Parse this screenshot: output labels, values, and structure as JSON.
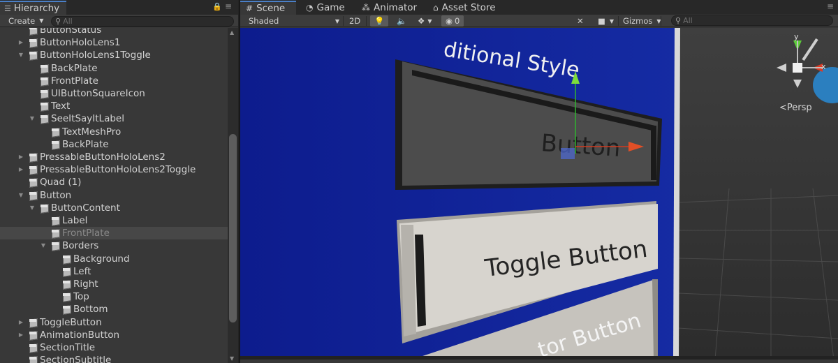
{
  "hierarchy": {
    "tab_label": "Hierarchy",
    "create_label": "Create",
    "search_placeholder": "All",
    "rows": [
      {
        "label": "ButtonStatus",
        "depth": 1,
        "fold": "",
        "dim": false,
        "sel": false
      },
      {
        "label": "ButtonHoloLens1",
        "depth": 1,
        "fold": "▶",
        "dim": false,
        "sel": false
      },
      {
        "label": "ButtonHoloLens1Toggle",
        "depth": 1,
        "fold": "▼",
        "dim": false,
        "sel": false
      },
      {
        "label": "BackPlate",
        "depth": 2,
        "fold": "",
        "dim": false,
        "sel": false
      },
      {
        "label": "FrontPlate",
        "depth": 2,
        "fold": "",
        "dim": false,
        "sel": false
      },
      {
        "label": "UIButtonSquareIcon",
        "depth": 2,
        "fold": "",
        "dim": false,
        "sel": false
      },
      {
        "label": "Text",
        "depth": 2,
        "fold": "",
        "dim": false,
        "sel": false
      },
      {
        "label": "SeeItSayItLabel",
        "depth": 2,
        "fold": "▼",
        "dim": false,
        "sel": false
      },
      {
        "label": "TextMeshPro",
        "depth": 3,
        "fold": "",
        "dim": false,
        "sel": false
      },
      {
        "label": "BackPlate",
        "depth": 3,
        "fold": "",
        "dim": false,
        "sel": false
      },
      {
        "label": "PressableButtonHoloLens2",
        "depth": 1,
        "fold": "▶",
        "dim": false,
        "sel": false
      },
      {
        "label": "PressableButtonHoloLens2Toggle",
        "depth": 1,
        "fold": "▶",
        "dim": false,
        "sel": false
      },
      {
        "label": "Quad (1)",
        "depth": 1,
        "fold": "",
        "dim": false,
        "sel": false
      },
      {
        "label": "Button",
        "depth": 1,
        "fold": "▼",
        "dim": false,
        "sel": false
      },
      {
        "label": "ButtonContent",
        "depth": 2,
        "fold": "▼",
        "dim": false,
        "sel": false
      },
      {
        "label": "Label",
        "depth": 3,
        "fold": "",
        "dim": false,
        "sel": false
      },
      {
        "label": "FrontPlate",
        "depth": 3,
        "fold": "",
        "dim": true,
        "sel": true
      },
      {
        "label": "Borders",
        "depth": 3,
        "fold": "▼",
        "dim": false,
        "sel": false
      },
      {
        "label": "Background",
        "depth": 4,
        "fold": "",
        "dim": false,
        "sel": false
      },
      {
        "label": "Left",
        "depth": 4,
        "fold": "",
        "dim": false,
        "sel": false
      },
      {
        "label": "Right",
        "depth": 4,
        "fold": "",
        "dim": false,
        "sel": false
      },
      {
        "label": "Top",
        "depth": 4,
        "fold": "",
        "dim": false,
        "sel": false
      },
      {
        "label": "Bottom",
        "depth": 4,
        "fold": "",
        "dim": false,
        "sel": false
      },
      {
        "label": "ToggleButton",
        "depth": 1,
        "fold": "▶",
        "dim": false,
        "sel": false
      },
      {
        "label": "AnimationButton",
        "depth": 1,
        "fold": "▶",
        "dim": false,
        "sel": false
      },
      {
        "label": "SectionTitle",
        "depth": 1,
        "fold": "",
        "dim": false,
        "sel": false
      },
      {
        "label": "SectionSubtitle",
        "depth": 1,
        "fold": "",
        "dim": false,
        "sel": false
      }
    ]
  },
  "scene": {
    "tabs": [
      {
        "label": "Scene",
        "icon": "grid-icon"
      },
      {
        "label": "Game",
        "icon": "pacman-icon"
      },
      {
        "label": "Animator",
        "icon": "animator-icon"
      },
      {
        "label": "Asset Store",
        "icon": "store-icon"
      }
    ],
    "toolbar": {
      "shading_mode": "Shaded",
      "mode_2d": "2D",
      "hidden_count": "0",
      "gizmos_label": "Gizmos",
      "search_placeholder": "All"
    },
    "viewport": {
      "title_text": "ditional Style",
      "button_text": "Button",
      "toggle_text": "Toggle Button",
      "third_text": "tor Button",
      "persp_label": "Persp",
      "axis_x": "x",
      "axis_y": "y"
    }
  }
}
